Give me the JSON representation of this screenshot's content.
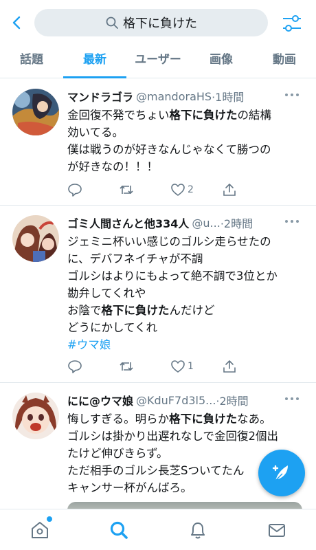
{
  "search": {
    "query": "格下に負けた"
  },
  "tabs": [
    {
      "label": "話題",
      "active": false
    },
    {
      "label": "最新",
      "active": true
    },
    {
      "label": "ユーザー",
      "active": false
    },
    {
      "label": "画像",
      "active": false
    },
    {
      "label": "動画",
      "active": false
    }
  ],
  "tweets": [
    {
      "name": "マンドラゴラ",
      "handle": "@mandoraHS",
      "time": "·1時間",
      "lines": [
        {
          "pre": "金回復不発でちょい",
          "bold": "格下に負けた",
          "post": "の結構"
        },
        {
          "pre": "効いてる。",
          "bold": "",
          "post": ""
        },
        {
          "pre": "僕は戦うのが好きなんじゃなくて勝つの",
          "bold": "",
          "post": ""
        },
        {
          "pre": "が好きなの！！！",
          "bold": "",
          "post": ""
        }
      ],
      "reply_count": "",
      "retweet_count": "",
      "like_count": "2"
    },
    {
      "name": "ゴミ人間さんと他334人",
      "handle": "@u...",
      "time": "·2時間",
      "lines": [
        {
          "pre": "ジェミニ杯いい感じのゴルシ走らせたの",
          "bold": "",
          "post": ""
        },
        {
          "pre": "に、デバフネイチャが不調",
          "bold": "",
          "post": ""
        },
        {
          "pre": "ゴルシはよりにもよって絶不調で3位とか",
          "bold": "",
          "post": ""
        },
        {
          "pre": "勘弁してくれや",
          "bold": "",
          "post": ""
        },
        {
          "pre": "お陰で",
          "bold": "格下に負けた",
          "post": "んだけど"
        },
        {
          "pre": "どうにかしてくれ",
          "bold": "",
          "post": ""
        }
      ],
      "hashtag": "#ウマ娘",
      "reply_count": "",
      "retweet_count": "",
      "like_count": "1"
    },
    {
      "name": "にに@ウマ娘",
      "handle": "@KduF7d3l5...",
      "time": "·2時間",
      "lines": [
        {
          "pre": "悔しすぎる。明らか",
          "bold": "格下に負けた",
          "post": "なあ。"
        },
        {
          "pre": "ゴルシは掛かり出遅れなしで金回復2個出",
          "bold": "",
          "post": ""
        },
        {
          "pre": "たけど伸びきらず。",
          "bold": "",
          "post": ""
        },
        {
          "pre": "ただ相手のゴルシ長芝Sついてたん",
          "bold": "",
          "post": ""
        },
        {
          "pre": "キャンサー杯がんばろ。",
          "bold": "",
          "post": ""
        }
      ]
    }
  ],
  "icons": {
    "back": "chevron-left-icon",
    "search": "search-icon",
    "filter": "sliders-icon",
    "compose": "compose-feather-icon",
    "nav": [
      "home-icon",
      "search-icon",
      "bell-icon",
      "mail-icon"
    ]
  },
  "colors": {
    "accent": "#1da1f2",
    "text": "#14171a",
    "muted": "#657786"
  }
}
